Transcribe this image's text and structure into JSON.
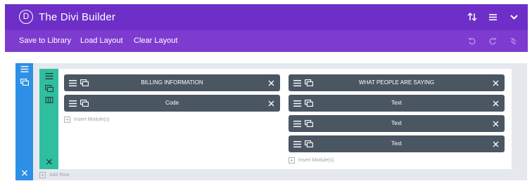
{
  "header": {
    "logo_letter": "D",
    "title": "The Divi Builder",
    "icons": [
      "sort-arrows-icon",
      "hamburger-menu-icon",
      "chevron-down-icon"
    ]
  },
  "toolbar": {
    "save_label": "Save to Library",
    "load_label": "Load Layout",
    "clear_label": "Clear Layout",
    "icons": [
      "undo-icon",
      "redo-icon",
      "history-icon"
    ]
  },
  "builder": {
    "columns": [
      {
        "modules": [
          "BILLING INFORMATION",
          "Code"
        ],
        "insert_label": "Insert Module(s)"
      },
      {
        "modules": [
          "WHAT PEOPLE ARE SAYING",
          "Text",
          "Text",
          "Text"
        ],
        "insert_label": "Insert Module(s)"
      }
    ],
    "add_row_label": "Add Row"
  },
  "colors": {
    "header_purple": "#6d2fc7",
    "toolbar_purple": "#7e3bd0",
    "section_blue": "#2d8fe5",
    "row_green": "#2fbfa0",
    "module_gray": "#4b5663",
    "section_bg": "#e5e9ed"
  }
}
